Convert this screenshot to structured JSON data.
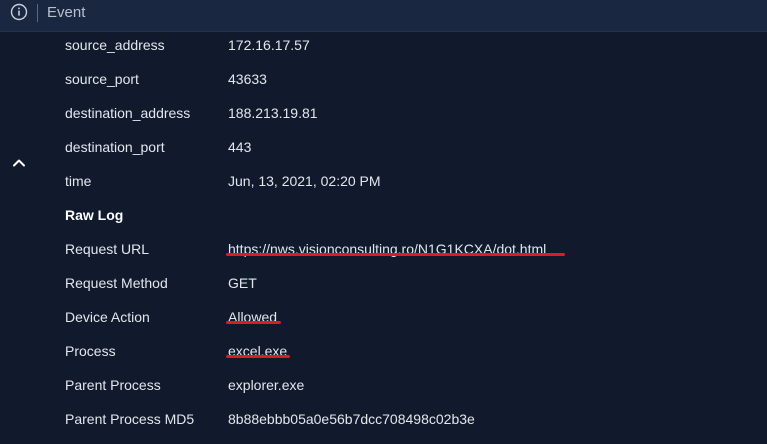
{
  "header": {
    "title": "Event",
    "info_icon": "info-circle-icon"
  },
  "collapse_icon": "chevron-up-icon",
  "fields": [
    {
      "label": "source_address",
      "value": "172.16.17.57"
    },
    {
      "label": "source_port",
      "value": "43633"
    },
    {
      "label": "destination_address",
      "value": "188.213.19.81"
    },
    {
      "label": "destination_port",
      "value": "443"
    },
    {
      "label": "time",
      "value": "Jun, 13, 2021, 02:20 PM"
    }
  ],
  "raw_log": {
    "heading": "Raw Log",
    "fields": [
      {
        "label": "Request URL",
        "value": "https://nws.visionconsulting.ro/N1G1KCXA/dot.html",
        "highlighted": true
      },
      {
        "label": "Request Method",
        "value": "GET",
        "highlighted": false
      },
      {
        "label": "Device Action",
        "value": "Allowed",
        "highlighted": true
      },
      {
        "label": "Process",
        "value": "excel.exe",
        "highlighted": true
      },
      {
        "label": "Parent Process",
        "value": "explorer.exe",
        "highlighted": false
      },
      {
        "label": "Parent Process MD5",
        "value": "8b88ebbb05a0e56b7dcc708498c02b3e",
        "highlighted": false
      }
    ]
  },
  "colors": {
    "background": "#101a2c",
    "header_background": "#1a2740",
    "highlight_underline": "#d71f1f",
    "text": "#e2e7ee"
  }
}
